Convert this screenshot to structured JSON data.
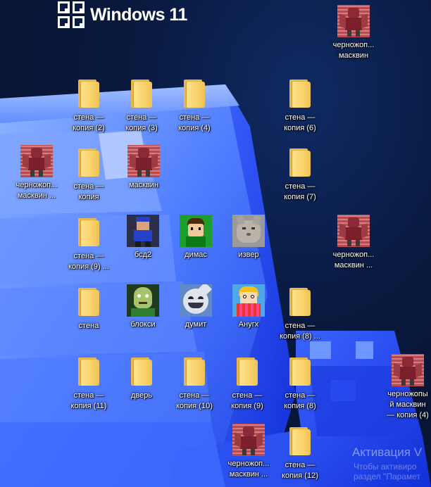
{
  "brand": {
    "logo_text": "Windows 11"
  },
  "desktop_icons": [
    {
      "label": "черножоп...\nмасквин",
      "kind": "character"
    },
    {
      "label": "стена —\nкопия (2)",
      "kind": "folder"
    },
    {
      "label": "стена —\nкопия (3)",
      "kind": "folder"
    },
    {
      "label": "стена —\nкопия (4)",
      "kind": "folder"
    },
    {
      "label": "стена —\nкопия (6)",
      "kind": "folder"
    },
    {
      "label": "черножоп...\nмасквин ...",
      "kind": "character"
    },
    {
      "label": "стена —\nкопия",
      "kind": "folder"
    },
    {
      "label": "масквин",
      "kind": "character"
    },
    {
      "label": "стена —\nкопия (7)",
      "kind": "folder"
    },
    {
      "label": "стена —\nкопия (9) ...",
      "kind": "folder"
    },
    {
      "label": "бсд2",
      "kind": "image"
    },
    {
      "label": "димас",
      "kind": "image"
    },
    {
      "label": "извер",
      "kind": "image"
    },
    {
      "label": "черножоп...\nмасквин ...",
      "kind": "character"
    },
    {
      "label": "стена",
      "kind": "folder"
    },
    {
      "label": "блокси",
      "kind": "image"
    },
    {
      "label": "думит",
      "kind": "image"
    },
    {
      "label": "Анугх",
      "kind": "image"
    },
    {
      "label": "стена —\nкопия (8) ...",
      "kind": "folder"
    },
    {
      "label": "стена —\nкопия (11)",
      "kind": "folder"
    },
    {
      "label": "дверь",
      "kind": "folder"
    },
    {
      "label": "стена —\nкопия (10)",
      "kind": "folder"
    },
    {
      "label": "стена —\nкопия (9)",
      "kind": "folder"
    },
    {
      "label": "стена —\nкопия (8)",
      "kind": "folder"
    },
    {
      "label": "черножопы\nй масквин\n— копия (4)",
      "kind": "character"
    },
    {
      "label": "черножоп...\nмасквин ...",
      "kind": "character"
    },
    {
      "label": "стена —\nкопия (12)",
      "kind": "folder"
    }
  ],
  "activation_watermark": {
    "title": "Активация V",
    "line1": "Чтобы активиро",
    "line2": "раздел \"Парамет"
  }
}
